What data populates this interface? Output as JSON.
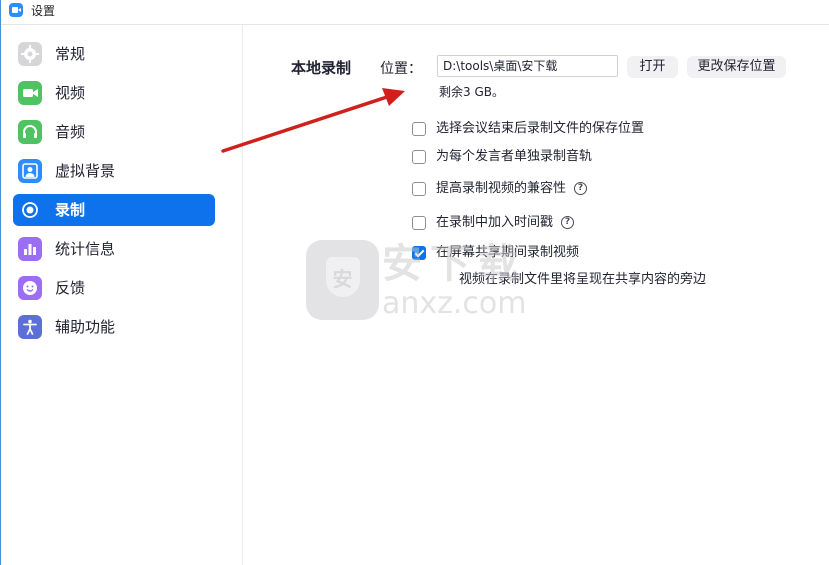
{
  "window": {
    "title": "设置"
  },
  "sidebar": {
    "items": [
      {
        "label": "常规",
        "icon": "gear-icon",
        "color": "#d6d6d9",
        "active": false
      },
      {
        "label": "视频",
        "icon": "video-camera-icon",
        "color": "#4fc264",
        "active": false
      },
      {
        "label": "音频",
        "icon": "headphones-icon",
        "color": "#4fc264",
        "active": false
      },
      {
        "label": "虚拟背景",
        "icon": "person-portrait-icon",
        "color": "#2d8cff",
        "active": false
      },
      {
        "label": "录制",
        "icon": "record-icon",
        "color": "#0e72ed",
        "active": true
      },
      {
        "label": "统计信息",
        "icon": "bar-chart-icon",
        "color": "#9b6ef3",
        "active": false
      },
      {
        "label": "反馈",
        "icon": "smiley-icon",
        "color": "#9b6ef3",
        "active": false
      },
      {
        "label": "辅助功能",
        "icon": "accessibility-person-icon",
        "color": "#5b6fd6",
        "active": false
      }
    ]
  },
  "recording": {
    "section_title": "本地录制",
    "location_label": "位置：",
    "path_value": "D:\\tools\\桌面\\安下载",
    "open_button": "打开",
    "change_button": "更改保存位置",
    "remaining": "剩余3 GB。",
    "options": [
      {
        "label": "选择会议结束后录制文件的保存位置",
        "checked": false,
        "help": false
      },
      {
        "label": "为每个发言者单独录制音轨",
        "checked": false,
        "help": false
      },
      {
        "label": "提高录制视频的兼容性",
        "checked": false,
        "help": true
      },
      {
        "label": "在录制中加入时间戳",
        "checked": false,
        "help": true
      },
      {
        "label": "在屏幕共享期间录制视频",
        "checked": true,
        "help": false
      }
    ],
    "sub_note": "视频在录制文件里将呈现在共享内容的旁边",
    "help_glyph": "?"
  },
  "watermark": {
    "logo_glyph": "安",
    "text_cn": "安下载",
    "text_en": "anxz.com"
  },
  "colors": {
    "accent": "#0e72ed",
    "annotation_arrow": "#d0201c"
  }
}
